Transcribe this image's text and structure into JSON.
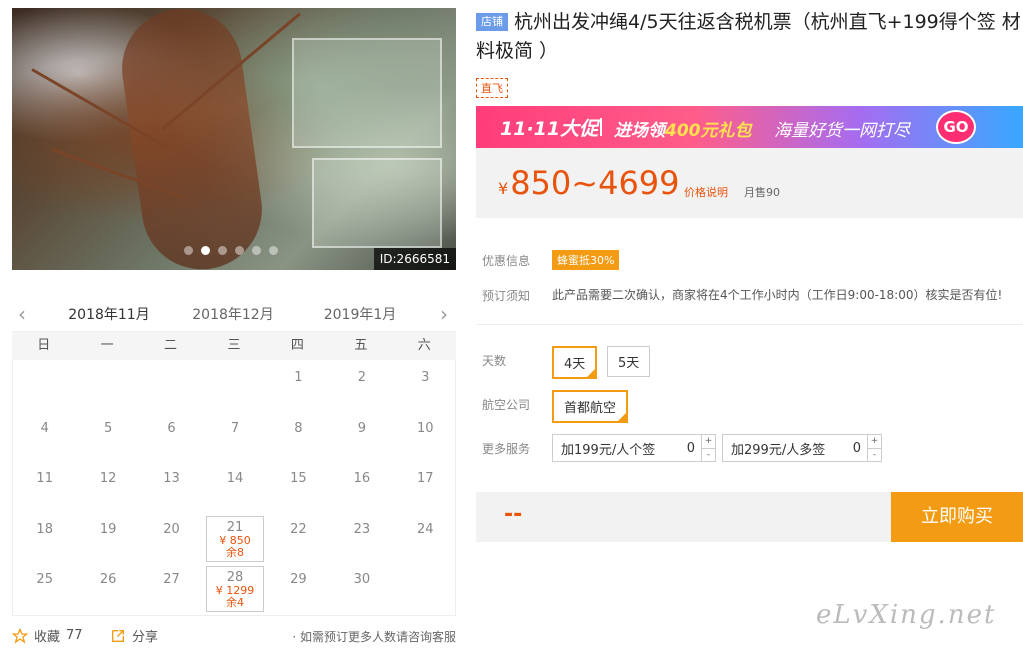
{
  "gallery": {
    "image_id": "ID:2666581",
    "dot_count": 6,
    "active_dot": 1
  },
  "calendar": {
    "prev_arrow": "‹",
    "next_arrow": "›",
    "months": [
      "2018年11月",
      "2018年12月",
      "2019年1月"
    ],
    "active_month": 0,
    "weekdays": [
      "日",
      "一",
      "二",
      "三",
      "四",
      "五",
      "六"
    ],
    "weeks": [
      [
        null,
        null,
        null,
        null,
        "1",
        "2",
        "3"
      ],
      [
        "4",
        "5",
        "6",
        "7",
        "8",
        "9",
        "10"
      ],
      [
        "11",
        "12",
        "13",
        "14",
        "15",
        "16",
        "17"
      ],
      [
        "18",
        "19",
        "20",
        "21",
        "22",
        "23",
        "24"
      ],
      [
        "25",
        "26",
        "27",
        "28",
        "29",
        "30",
        null
      ]
    ],
    "available": {
      "21": {
        "price": "¥ 850",
        "stock": "余8"
      },
      "28": {
        "price": "¥ 1299",
        "stock": "余4"
      }
    }
  },
  "actions": {
    "favorite_label": "收藏",
    "favorite_count": "77",
    "share_label": "分享",
    "consult_text": "· 如需预订更多人数请咨询客服"
  },
  "product": {
    "shop_tag": "店铺",
    "title": "杭州出发冲绳4/5天往返含税机票（杭州直飞+199得个签 材料极简 ）",
    "direct_tag": "直飞"
  },
  "banner": {
    "t1": "11·11大促",
    "t2_a": "进场领",
    "t2_b": "400元礼包",
    "t3": "海量好货一网打尽",
    "go": "GO"
  },
  "price": {
    "currency": "¥",
    "range": "850~4699",
    "explain": "价格说明",
    "monthly": "月售90"
  },
  "info": {
    "discount_label": "优惠信息",
    "discount_badge": "蜂蜜抵30%",
    "notice_label": "预订须知",
    "notice_text": "此产品需要二次确认，商家将在4个工作小时内（工作日9:00-18:00）核实是否有位!"
  },
  "options": {
    "days_label": "天数",
    "days": [
      "4天",
      "5天"
    ],
    "days_selected": 0,
    "airline_label": "航空公司",
    "airline": "首都航空",
    "service_label": "更多服务",
    "services": [
      {
        "name": "加199元/人个签",
        "qty": "0"
      },
      {
        "name": "加299元/人多签",
        "qty": "0"
      }
    ],
    "stepper_up": "+",
    "stepper_down": "-"
  },
  "buy": {
    "total": "--",
    "button": "立即购买"
  },
  "watermark": "eLvXing.net",
  "colors": {
    "accent": "#f39b12",
    "price": "#e8540e"
  }
}
